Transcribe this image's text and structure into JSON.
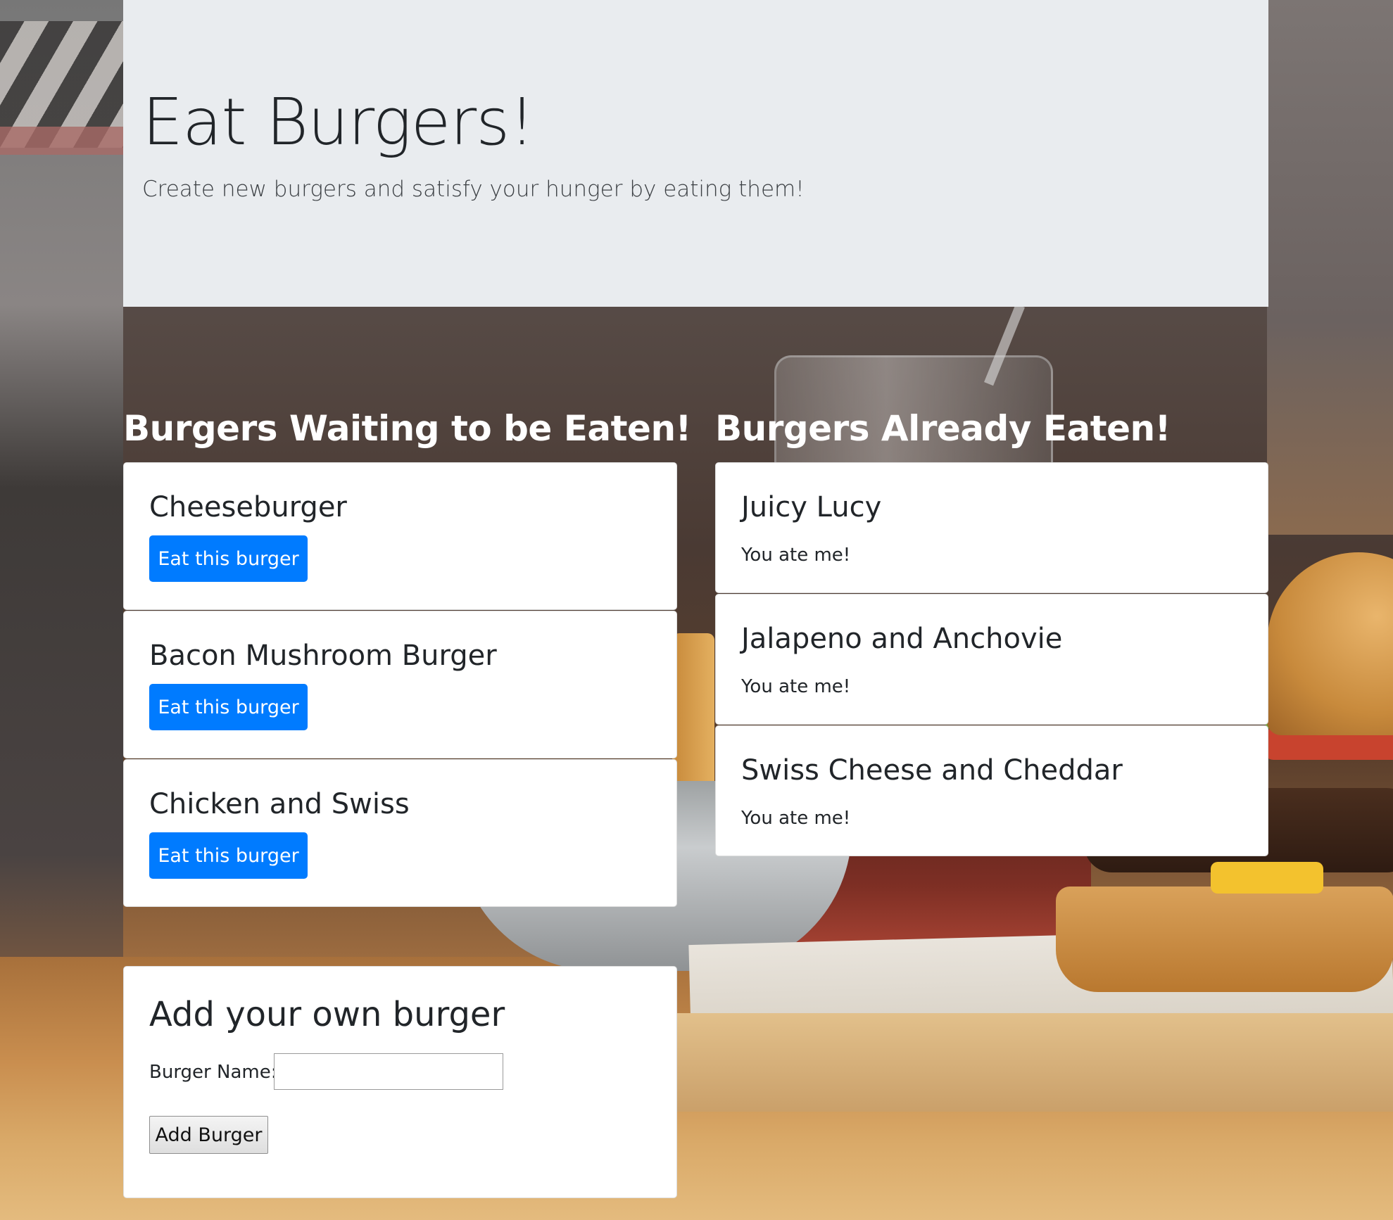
{
  "header": {
    "title": "Eat Burgers!",
    "subtitle": "Create new burgers and satisfy your hunger by eating them!"
  },
  "waiting": {
    "heading": "Burgers Waiting to be Eaten!",
    "items": [
      {
        "name": "Cheeseburger",
        "button_label": "Eat this burger"
      },
      {
        "name": "Bacon Mushroom Burger",
        "button_label": "Eat this burger"
      },
      {
        "name": "Chicken and Swiss",
        "button_label": "Eat this burger"
      }
    ]
  },
  "eaten": {
    "heading": "Burgers Already Eaten!",
    "items": [
      {
        "name": "Juicy Lucy",
        "note": "You ate me!"
      },
      {
        "name": "Jalapeno and Anchovie",
        "note": "You ate me!"
      },
      {
        "name": "Swiss Cheese and Cheddar",
        "note": "You ate me!"
      }
    ]
  },
  "add_form": {
    "heading": "Add your own burger",
    "name_label": "Burger Name:",
    "name_value": "",
    "submit_label": "Add Burger"
  },
  "colors": {
    "primary_button": "#007bff",
    "jumbotron_bg": "#e9ecef"
  }
}
